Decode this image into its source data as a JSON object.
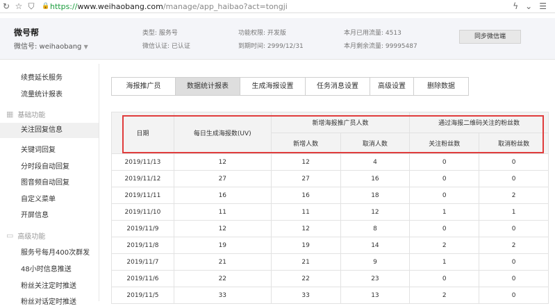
{
  "browser": {
    "url_scheme": "https://",
    "url_host": "www.weihaobang.com",
    "url_path": "/manage/app_haibao?act=tongji"
  },
  "header": {
    "brand": "微号帮",
    "wechat_id": "微信号: weihaobang",
    "type_label": "类型: 服务号",
    "verify_label": "微信认证: 已认证",
    "perm_label": "功能权限: 开发版",
    "expire_label": "到期时间: 2999/12/31",
    "used_label": "本月已用流量: 4513",
    "remain_label": "本月剩余流量: 99995487",
    "sync_button": "同步微信端"
  },
  "sidebar": {
    "items_top": [
      "续费延长服务",
      "流量统计报表"
    ],
    "section_basic": "基础功能",
    "items_basic": [
      "关注回复信息",
      "关键词回复",
      "分时段自动回复",
      "图音频自动回复",
      "自定义菜单",
      "开屏信息"
    ],
    "section_advanced": "高级功能",
    "items_advanced": [
      "服务号每月400次群发",
      "48小时信息推送",
      "粉丝关注定时推送",
      "粉丝对话定时推送"
    ]
  },
  "tabs": [
    "海报推广员",
    "数据统计报表",
    "生成海报设置",
    "任务消息设置",
    "高级设置",
    "删除数据"
  ],
  "table": {
    "col_date": "日期",
    "col_daily": "每日生成海报数(UV)",
    "group_promoter": "新增海报推广员人数",
    "group_fans": "通过海报二维码关注的粉丝数",
    "col_new": "新增人数",
    "col_cancel": "取消人数",
    "col_follow": "关注粉丝数",
    "col_unfollow": "取消粉丝数",
    "rows": [
      {
        "date": "2019/11/13",
        "daily": "12",
        "new": "12",
        "cancel": "4",
        "follow": "0",
        "unfollow": "0"
      },
      {
        "date": "2019/11/12",
        "daily": "27",
        "new": "27",
        "cancel": "16",
        "follow": "0",
        "unfollow": "0"
      },
      {
        "date": "2019/11/11",
        "daily": "16",
        "new": "16",
        "cancel": "18",
        "follow": "0",
        "unfollow": "2"
      },
      {
        "date": "2019/11/10",
        "daily": "11",
        "new": "11",
        "cancel": "12",
        "follow": "1",
        "unfollow": "1"
      },
      {
        "date": "2019/11/9",
        "daily": "12",
        "new": "12",
        "cancel": "8",
        "follow": "0",
        "unfollow": "0"
      },
      {
        "date": "2019/11/8",
        "daily": "19",
        "new": "19",
        "cancel": "14",
        "follow": "2",
        "unfollow": "2"
      },
      {
        "date": "2019/11/7",
        "daily": "21",
        "new": "21",
        "cancel": "9",
        "follow": "1",
        "unfollow": "0"
      },
      {
        "date": "2019/11/6",
        "daily": "22",
        "new": "22",
        "cancel": "23",
        "follow": "0",
        "unfollow": "0"
      },
      {
        "date": "2019/11/5",
        "daily": "33",
        "new": "33",
        "cancel": "13",
        "follow": "2",
        "unfollow": "0"
      }
    ]
  },
  "colors": {
    "highlight": "#e03b3b",
    "secure": "#1a9c3c",
    "active_tab": "#dedede"
  }
}
